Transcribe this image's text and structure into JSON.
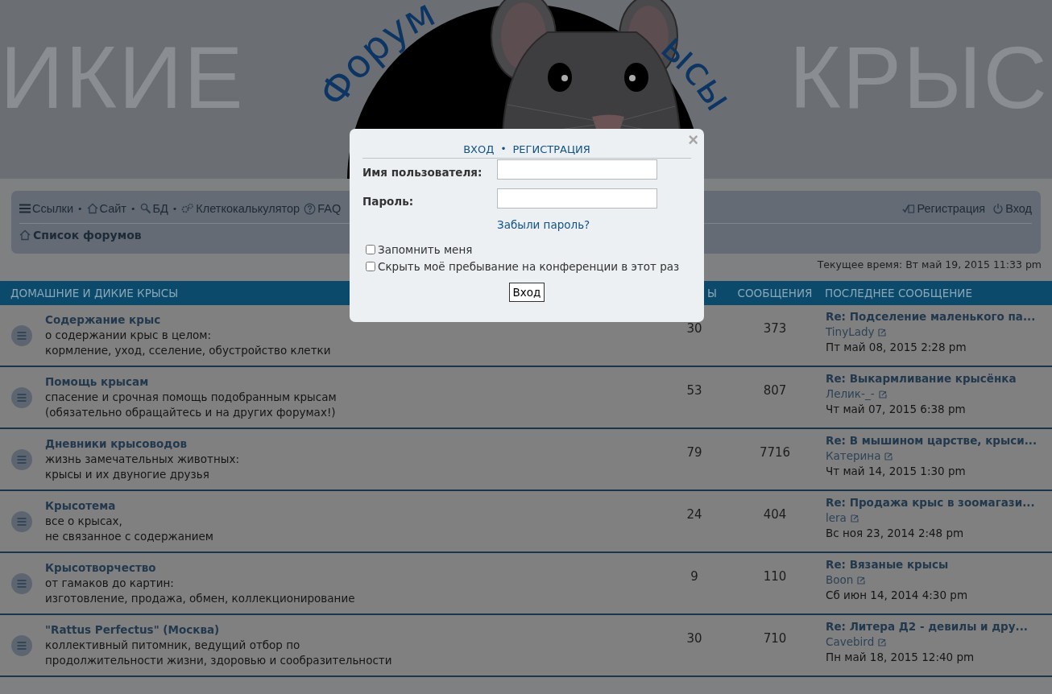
{
  "header": {
    "banner_left": "ИКИЕ",
    "banner_right": "КРЫС",
    "logo_left": "Форум",
    "logo_right": "ысы"
  },
  "nav": {
    "links": [
      {
        "label": "Ссылки"
      },
      {
        "label": "Сайт",
        "bullet": "•"
      },
      {
        "label": "БД",
        "bullet": "•"
      },
      {
        "label": "Клеткокалькулятор",
        "bullet": "•"
      },
      {
        "label": "FAQ"
      }
    ],
    "right": [
      {
        "label": "Регистрация"
      },
      {
        "label": "Вход"
      }
    ],
    "breadcrumb": "Список форумов"
  },
  "current_time": "Текущее время: Вт май 19, 2015 11:33 pm",
  "table": {
    "columns": [
      "ДОМАШНИЕ И ДИКИЕ КРЫСЫ",
      "Ы",
      "СООБЩЕНИЯ",
      "ПОСЛЕДНЕЕ СООБЩЕНИЕ"
    ],
    "rows": [
      {
        "title": "Содержание крыс",
        "description": [
          "о содержании крыс в целом:",
          "кормление, уход, сселение, обустройство клетки"
        ],
        "topics": "30",
        "posts": "373",
        "last_post": {
          "title": "Re: Подселение маленького па...",
          "author": "TinyLady",
          "time": "Пт май 08, 2015 2:28 pm"
        }
      },
      {
        "title": "Помощь крысам",
        "description": [
          "спасение и срочная помощь подобранным крысам",
          "(обязательно обращайтесь и на других форумах!)"
        ],
        "topics": "53",
        "posts": "807",
        "last_post": {
          "title": "Re: Выкармливание крысёнка",
          "author": "Лелик-_-",
          "time": "Чт май 07, 2015 6:38 pm"
        }
      },
      {
        "title": "Дневники крысоводов",
        "description": [
          "жизнь замечательных животных:",
          "крысы и их двуногие друзья"
        ],
        "topics": "79",
        "posts": "7716",
        "last_post": {
          "title": "Re: В мышином царстве, крыси...",
          "author": "Катерина",
          "time": "Чт май 14, 2015 1:30 pm"
        }
      },
      {
        "title": "Крысотема",
        "description": [
          "все о крысах,",
          "не связанное с содержанием"
        ],
        "topics": "24",
        "posts": "404",
        "last_post": {
          "title": "Re: Продажа крыс в зоомагази...",
          "author": "lera",
          "time": "Вс ноя 23, 2014 2:48 pm"
        }
      },
      {
        "title": "Крысотворчество",
        "description": [
          "от гамаков до картин:",
          "изготовление, продажа, обмен, коллекционирование"
        ],
        "topics": "9",
        "posts": "110",
        "last_post": {
          "title": "Re: Вязаные крысы",
          "author": "Boon",
          "time": "Сб июн 14, 2014 4:30 pm"
        }
      },
      {
        "title": "\"Rattus Perfectus\" (Москва)",
        "description": [
          "коллективный питомник, ведущий отбор по",
          "продолжительности жизни, здоровью и сообразительности"
        ],
        "topics": "30",
        "posts": "710",
        "last_post": {
          "title": "Re: Литера Д2 - девилы и дру...",
          "author": "Cavebird",
          "time": "Пн май 18, 2015 12:40 pm"
        }
      }
    ]
  },
  "login_modal": {
    "close": "×",
    "tabs": [
      "ВХОД",
      "РЕГИСТРАЦИЯ"
    ],
    "tab_separator": "•",
    "fields": [
      {
        "label": "Имя пользователя:"
      },
      {
        "label": "Пароль:"
      }
    ],
    "forgot": "Забыли пароль?",
    "checkboxes": [
      {
        "label": "Запомнить меня",
        "checked": false
      },
      {
        "label": "Скрыть моё пребывание на конференции в этот раз",
        "checked": false
      }
    ],
    "submit": "Вход"
  }
}
